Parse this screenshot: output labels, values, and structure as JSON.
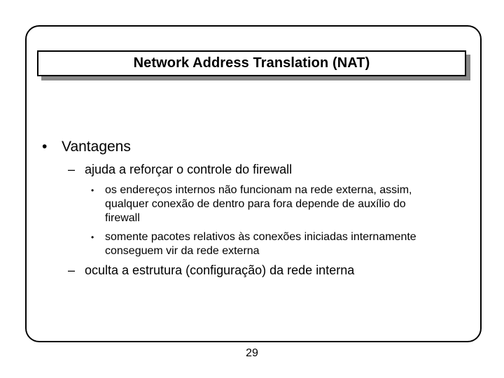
{
  "slide": {
    "title": "Network Address Translation (NAT)",
    "bullets": [
      {
        "marker": "•",
        "text": "Vantagens",
        "children": [
          {
            "marker": "–",
            "text": "ajuda a reforçar o controle do firewall",
            "children": [
              {
                "marker": "•",
                "lines": [
                  "os endereços internos não funcionam na rede externa, assim,",
                  "qualquer conexão de dentro para fora depende de auxílio do",
                  "firewall"
                ]
              },
              {
                "marker": "•",
                "lines": [
                  "somente pacotes relativos às conexões iniciadas internamente",
                  "conseguem vir da rede externa"
                ]
              }
            ]
          },
          {
            "marker": "–",
            "text": "oculta a estrutura (configuração) da rede interna"
          }
        ]
      }
    ],
    "page_number": "29"
  }
}
